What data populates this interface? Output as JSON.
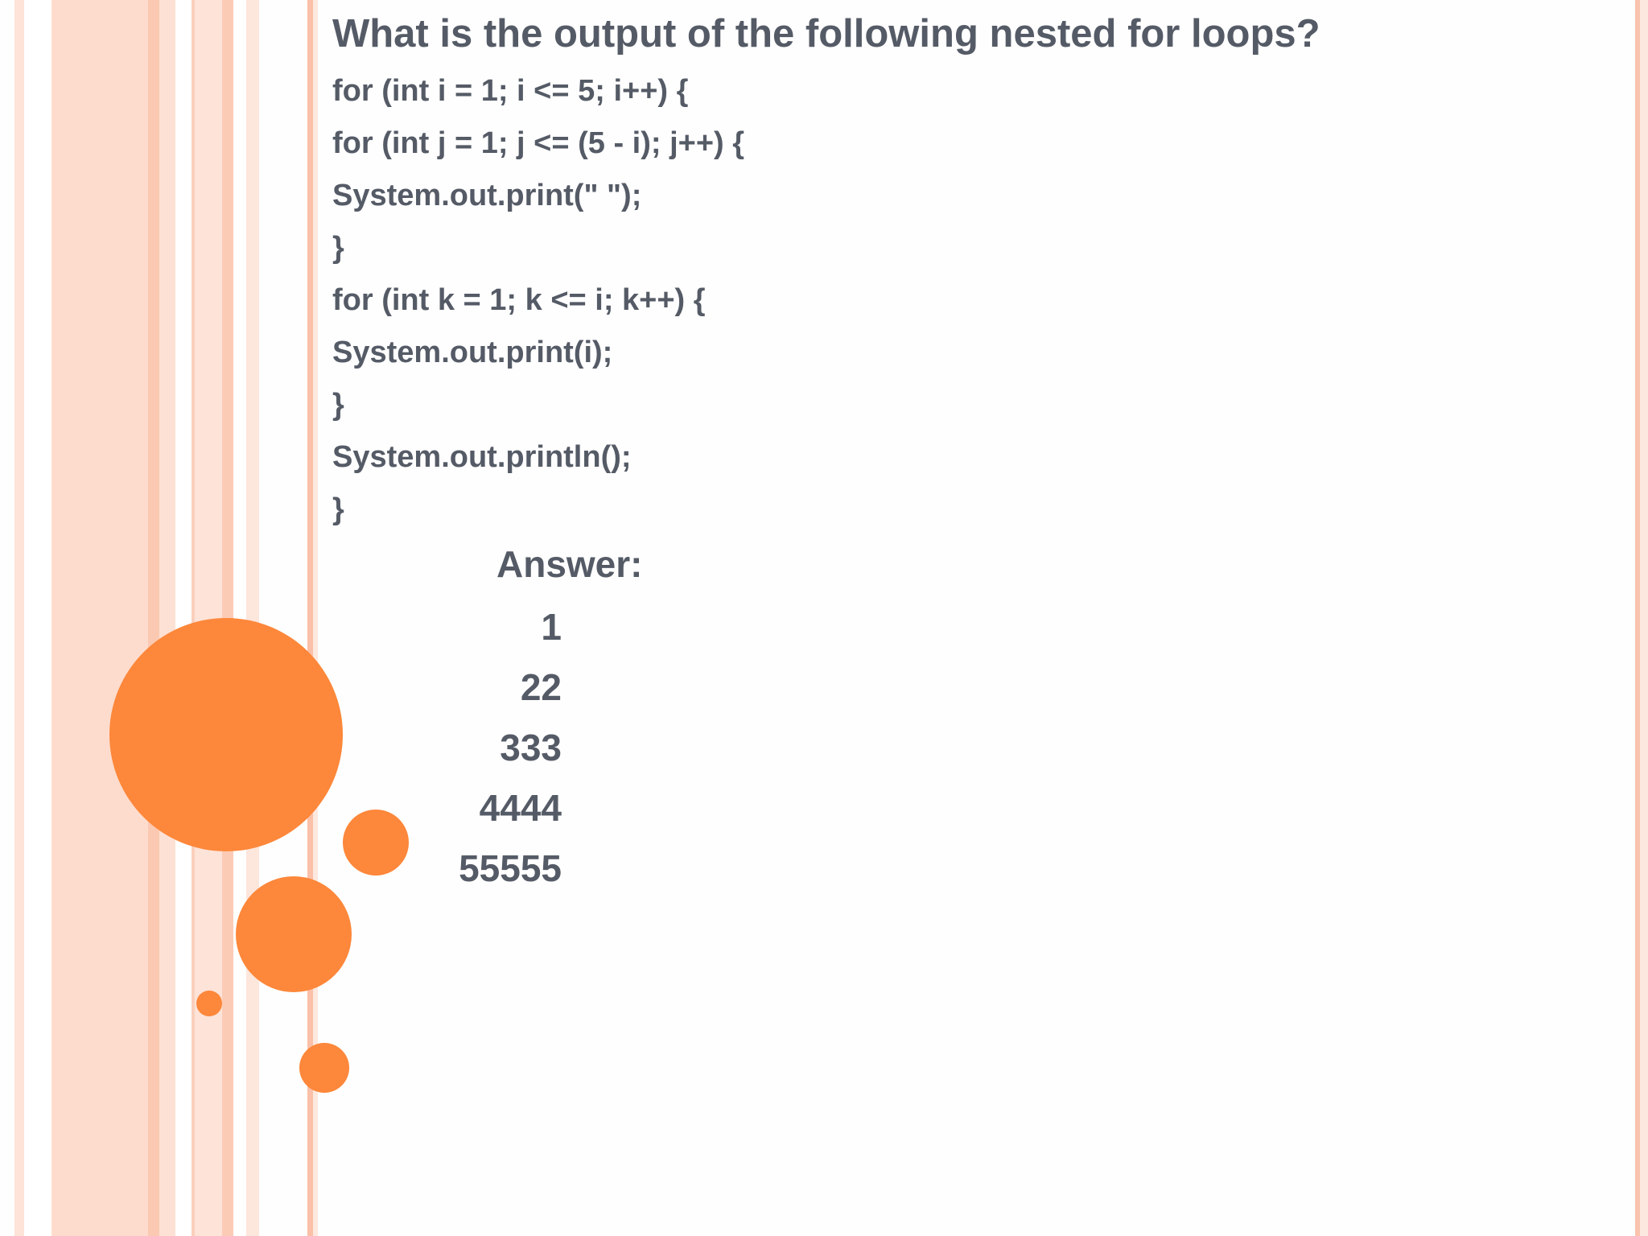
{
  "slide": {
    "title": "What is the output of the following nested for loops?",
    "code_lines": [
      "for (int i = 1; i <= 5; i++) {",
      "for (int j = 1; j <= (5 - i); j++) {",
      "System.out.print(\" \");",
      "}",
      "for (int k = 1; k <= i; k++) {",
      "System.out.print(i);",
      "}",
      "System.out.println();",
      "}"
    ],
    "answer_label": "Answer:",
    "output_lines": [
      "1",
      "22",
      "333",
      "4444",
      "55555"
    ]
  },
  "colors": {
    "text": "#555b66",
    "accent_circle": "#fd873a",
    "stripe_light": "#fde3d8",
    "stripe_medium": "#fbc9b2"
  }
}
